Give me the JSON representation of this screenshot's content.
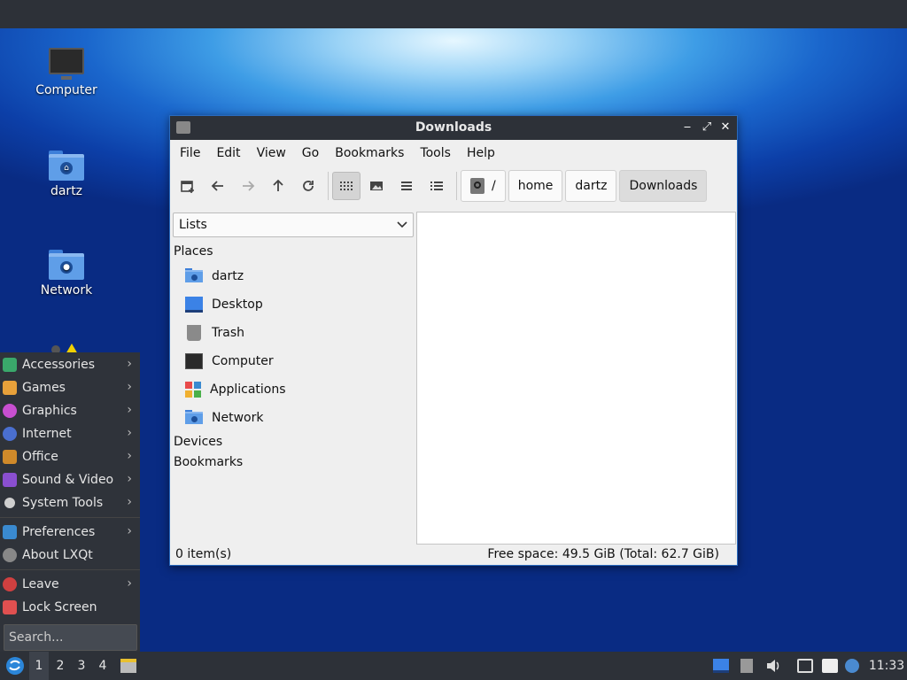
{
  "desktop": {
    "icons": [
      {
        "label": "Computer"
      },
      {
        "label": "dartz"
      },
      {
        "label": "Network"
      }
    ]
  },
  "window": {
    "title": "Downloads",
    "controls": {
      "minimize": "‒",
      "maximize": "⤢",
      "close": "✕"
    },
    "menu": [
      "File",
      "Edit",
      "View",
      "Go",
      "Bookmarks",
      "Tools",
      "Help"
    ],
    "toolbar_icons": [
      "new-tab-icon",
      "back-icon",
      "forward-icon",
      "up-icon",
      "reload-icon",
      "icon-view-icon",
      "thumbnail-view-icon",
      "compact-view-icon",
      "detailed-list-icon"
    ],
    "path": [
      "/",
      "home",
      "dartz",
      "Downloads"
    ],
    "side_mode": "Lists",
    "sections": {
      "places": "Places",
      "devices": "Devices",
      "bookmarks": "Bookmarks"
    },
    "places": [
      "dartz",
      "Desktop",
      "Trash",
      "Computer",
      "Applications",
      "Network"
    ],
    "status_left": "0 item(s)",
    "status_right": "Free space: 49.5 GiB (Total: 62.7 GiB)"
  },
  "start_menu": {
    "items": [
      "Accessories",
      "Games",
      "Graphics",
      "Internet",
      "Office",
      "Sound & Video",
      "System Tools"
    ],
    "items2": [
      "Preferences",
      "About LXQt"
    ],
    "items3": [
      "Leave",
      "Lock Screen"
    ],
    "search_placeholder": "Search...",
    "colors": {
      "accessories": "#3aa86b",
      "games": "#e8a13a",
      "graphics": "#c84fd0",
      "internet": "#4a6fd0",
      "office": "#d08a2a",
      "sound": "#8a4fd0",
      "system": "#cfcfcf",
      "preferences": "#3a8ad0",
      "about": "#888888",
      "leave": "#d04040",
      "lock": "#e05050"
    }
  },
  "taskbar": {
    "desktops": [
      "1",
      "2",
      "3",
      "4"
    ],
    "clock": "11:33"
  }
}
